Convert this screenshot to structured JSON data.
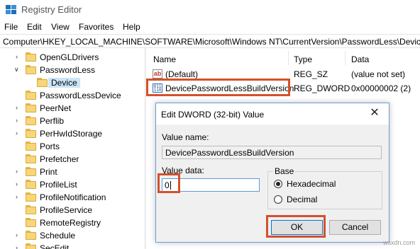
{
  "window": {
    "title": "Registry Editor",
    "icon": "registry-editor-icon"
  },
  "menu": [
    "File",
    "Edit",
    "View",
    "Favorites",
    "Help"
  ],
  "address": "Computer\\HKEY_LOCAL_MACHINE\\SOFTWARE\\Microsoft\\Windows NT\\CurrentVersion\\PasswordLess\\Device",
  "tree": {
    "items": [
      {
        "label": "OpenGLDrivers",
        "expanded": false
      },
      {
        "label": "PasswordLess",
        "expanded": true
      },
      {
        "label": "Device",
        "selected": true
      },
      {
        "label": "PasswordLessDevice",
        "expanded": false
      },
      {
        "label": "PeerNet",
        "expanded": false
      },
      {
        "label": "Perflib",
        "expanded": false
      },
      {
        "label": "PerHwIdStorage",
        "expanded": false
      },
      {
        "label": "Ports",
        "expanded": false
      },
      {
        "label": "Prefetcher",
        "expanded": false
      },
      {
        "label": "Print",
        "expanded": false
      },
      {
        "label": "ProfileList",
        "expanded": false
      },
      {
        "label": "ProfileNotification",
        "expanded": false
      },
      {
        "label": "ProfileService",
        "expanded": false
      },
      {
        "label": "RemoteRegistry",
        "expanded": false
      },
      {
        "label": "Schedule",
        "expanded": false
      },
      {
        "label": "SecEdit",
        "expanded": false
      }
    ]
  },
  "list": {
    "columns": [
      "Name",
      "Type",
      "Data"
    ],
    "rows": [
      {
        "icon": "string-value-icon",
        "name": "(Default)",
        "type": "REG_SZ",
        "data": "(value not set)"
      },
      {
        "icon": "binary-value-icon",
        "name": "DevicePasswordLessBuildVersion",
        "type": "REG_DWORD",
        "data": "0x00000002 (2)"
      }
    ]
  },
  "dialog": {
    "title": "Edit DWORD (32-bit) Value",
    "value_name_label": "Value name:",
    "value_name": "DevicePasswordLessBuildVersion",
    "value_data_label": "Value data:",
    "value_data": "0",
    "base_label": "Base",
    "base_options": [
      {
        "label": "Hexadecimal",
        "checked": true
      },
      {
        "label": "Decimal",
        "checked": false
      }
    ],
    "ok_label": "OK",
    "cancel_label": "Cancel"
  },
  "highlight_color": "#d4512b",
  "watermark": "wsxdn.com"
}
